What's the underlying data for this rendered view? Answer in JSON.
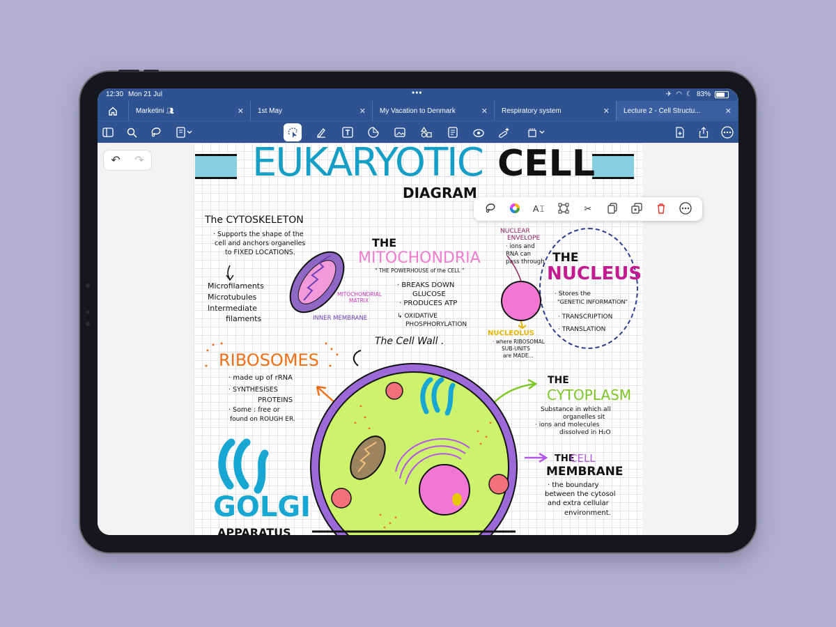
{
  "status": {
    "time": "12:30",
    "date": "Mon 21 Jul",
    "battery": "83%"
  },
  "tabs": [
    {
      "label": "Marketini"
    },
    {
      "label": "1st May"
    },
    {
      "label": "My Vacation to Denmark"
    },
    {
      "label": "Respiratory system"
    },
    {
      "label": "Lecture 2 - Cell Structu..."
    }
  ],
  "toolbar": {
    "icons": [
      "sidebar-icon",
      "search-icon",
      "lasso-icon",
      "document-menu-icon",
      "lasso-select-icon",
      "pen-icon",
      "text-icon",
      "sticker-icon",
      "image-icon",
      "shapes-icon",
      "note-icon",
      "laser-icon",
      "magic-icon",
      "elements-icon",
      "add-page-icon",
      "share-icon",
      "more-icon"
    ]
  },
  "popup": {
    "icons": [
      "lasso-icon",
      "color-wheel-icon",
      "ai-icon",
      "resize-icon",
      "scissors-icon",
      "copy-icon",
      "duplicate-icon",
      "delete-icon",
      "more-icon"
    ]
  },
  "notes": {
    "title_a": "EUKARYOTIC",
    "title_b": "CELL",
    "subtitle": "DIAGRAM",
    "cytoskeleton": {
      "heading": "The CYTOSKELETON",
      "l1": "· Supports the shape of the",
      "l2": "cell and anchors organelles",
      "l3": "to FIXED LOCATIONS.",
      "i1": "Microfilaments",
      "i2": "Microtubules",
      "i3": "Intermediate",
      "i4": "filaments"
    },
    "mitochondria": {
      "the": "THE",
      "heading": "MITOCHONDRIA",
      "quote": "\" THE POWERHOUSE of the CELL \"",
      "matrix1": "MITOCHONDRIAL",
      "matrix2": "MATRIX",
      "inner": "INNER MEMBRANE",
      "b1": "· BREAKS DOWN",
      "b2": "GLUCOSE",
      "b3": "· PRODUCES ATP",
      "b4": "↳ OXIDATIVE",
      "b5": "PHOSPHORYLATION"
    },
    "nucleus": {
      "env1": "NUCLEAR",
      "env2": "ENVELOPE",
      "env3": "· ions and",
      "env4": "RNA can",
      "env5": "pass through",
      "the": "THE",
      "heading": "NUCLEUS",
      "l1": "· Stores the",
      "l2": "\"GENETIC INFORMATION\"",
      "l3": "· TRANSCRIPTION",
      "l4": "· TRANSLATION",
      "nucleolus": "NUCLEOLUS",
      "n1": "· where RIBOSOMAL",
      "n2": "SUB-UNITS",
      "n3": "are MADE..."
    },
    "cellwall": "The Cell Wall .",
    "ribosomes": {
      "heading": "RIBOSOMES",
      "l1": "· made up of rRNA",
      "l2": "· SYNTHESISES",
      "l3": "PROTEINS",
      "l4": "· Some : free or",
      "l5": "found on ROUGH ER."
    },
    "cytoplasm": {
      "the": "THE",
      "heading": "CYTOPLASM",
      "l1": "Substance in which all",
      "l2": "organelles sit",
      "l3": "· ions and molecules",
      "l4": "dissolved in H₂O"
    },
    "membrane": {
      "the": "THE",
      "cell": "CELL",
      "heading": "MEMBRANE",
      "l1": "· the boundary",
      "l2": "between the cytosol",
      "l3": "and extra cellular",
      "l4": "environment."
    },
    "golgi": "GOLGI",
    "golgi_sub": "APPARATUS"
  }
}
